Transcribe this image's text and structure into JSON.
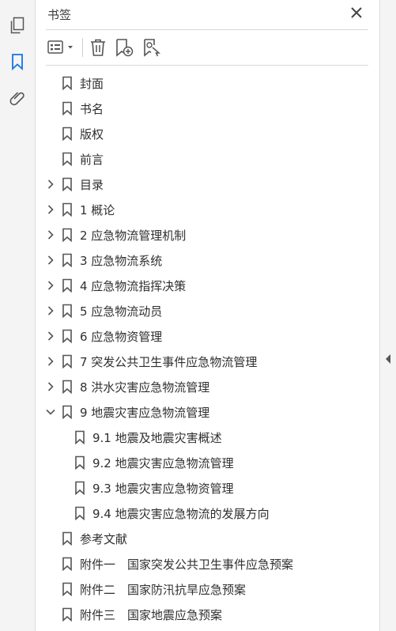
{
  "panel": {
    "title": "书签",
    "toolbar": {
      "options_icon": "list-options-icon",
      "delete_icon": "trash-icon",
      "new_bookmark_icon": "new-bookmark-icon",
      "find_bookmark_icon": "find-bookmark-icon"
    }
  },
  "sidebar": {
    "tools": [
      "page-thumbnails-icon",
      "bookmarks-icon",
      "attachments-icon"
    ],
    "active_color": "#1473e6"
  },
  "bookmarks": [
    {
      "label": "封面",
      "level": 0,
      "expander": "none"
    },
    {
      "label": "书名",
      "level": 0,
      "expander": "none"
    },
    {
      "label": "版权",
      "level": 0,
      "expander": "none"
    },
    {
      "label": "前言",
      "level": 0,
      "expander": "none"
    },
    {
      "label": "目录",
      "level": 0,
      "expander": "collapsed"
    },
    {
      "label": "1 概论",
      "level": 0,
      "expander": "collapsed"
    },
    {
      "label": "2 应急物流管理机制",
      "level": 0,
      "expander": "collapsed"
    },
    {
      "label": "3 应急物流系统",
      "level": 0,
      "expander": "collapsed"
    },
    {
      "label": "4 应急物流指挥决策",
      "level": 0,
      "expander": "collapsed"
    },
    {
      "label": "5 应急物流动员",
      "level": 0,
      "expander": "collapsed"
    },
    {
      "label": "6 应急物资管理",
      "level": 0,
      "expander": "collapsed"
    },
    {
      "label": "7 突发公共卫生事件应急物流管理",
      "level": 0,
      "expander": "collapsed"
    },
    {
      "label": "8 洪水灾害应急物流管理",
      "level": 0,
      "expander": "collapsed"
    },
    {
      "label": "9 地震灾害应急物流管理",
      "level": 0,
      "expander": "expanded"
    },
    {
      "label": "9.1 地震及地震灾害概述",
      "level": 1,
      "expander": "none"
    },
    {
      "label": "9.2 地震灾害应急物流管理",
      "level": 1,
      "expander": "none"
    },
    {
      "label": "9.3 地震灾害应急物资管理",
      "level": 1,
      "expander": "none"
    },
    {
      "label": "9.4 地震灾害应急物流的发展方向",
      "level": 1,
      "expander": "none"
    },
    {
      "label": "参考文献",
      "level": 0,
      "expander": "none"
    },
    {
      "label": "附件一　国家突发公共卫生事件应急预案",
      "level": 0,
      "expander": "none"
    },
    {
      "label": "附件二　国家防汛抗旱应急预案",
      "level": 0,
      "expander": "none"
    },
    {
      "label": "附件三　国家地震应急预案",
      "level": 0,
      "expander": "none"
    }
  ]
}
